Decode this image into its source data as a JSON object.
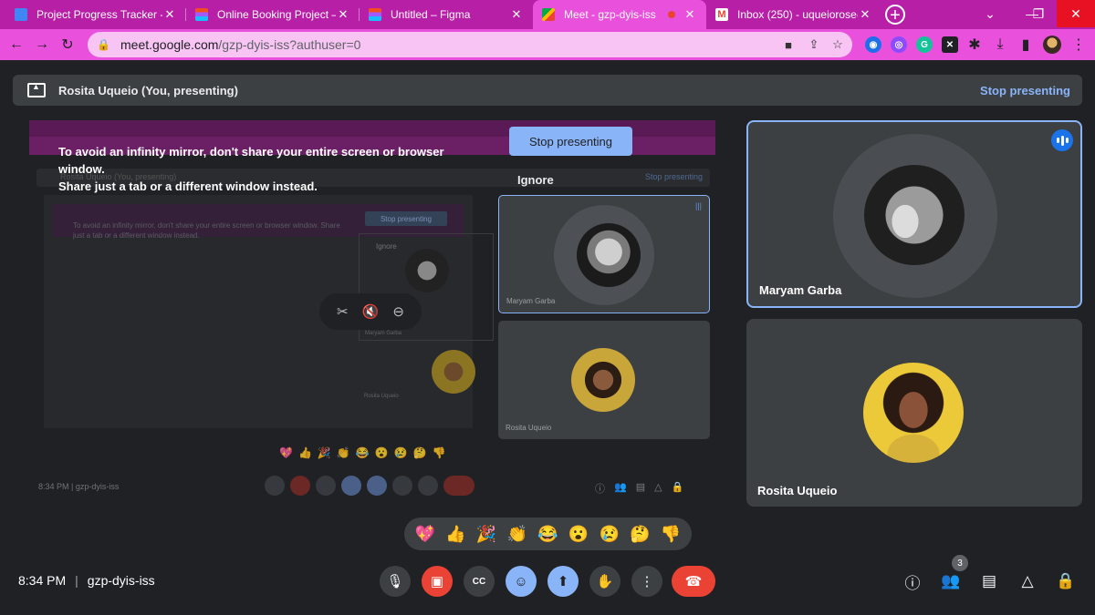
{
  "browser": {
    "tabs": [
      {
        "title": "Project Progress Tracker - Go",
        "icon": "docs-icon",
        "color": "#4285f4"
      },
      {
        "title": "Online Booking Project – Fig",
        "icon": "figma-icon",
        "color": "#a259ff"
      },
      {
        "title": "Untitled – Figma",
        "icon": "figma-icon",
        "color": "#a259ff"
      },
      {
        "title": "Meet - gzp-dyis-iss",
        "icon": "meet-icon",
        "color": "#00ac47"
      },
      {
        "title": "Inbox (250) - uqueiorose@g",
        "icon": "gmail-icon",
        "color": "#ea4335"
      }
    ],
    "url": "meet.google.com",
    "url_path": "/gzp-dyis-iss?authuser=0"
  },
  "presenting": {
    "label": "Rosita Uqueio (You, presenting)",
    "stop_link": "Stop presenting"
  },
  "mirror_warning": {
    "line1": "To avoid an infinity mirror, don't share your entire screen or browser window.",
    "line2": "Share just a tab or a different window instead.",
    "stop_button": "Stop presenting",
    "ignore": "Ignore"
  },
  "mirror_preview": {
    "presenting_label": "Rosita Uqueio (You, presenting)",
    "stop_link": "Stop presenting",
    "warning": "To avoid an infinity mirror, don't share your entire screen or browser window. Share just a tab or a different window instead.",
    "stop_button": "Stop presenting",
    "ignore": "Ignore",
    "tile1_name": "Maryam Garba",
    "tile2_name": "Rosita Uqueio",
    "time": "8:34 PM",
    "code": "gzp-dyis-iss"
  },
  "participants": [
    {
      "name": "Maryam Garba",
      "speaking": true
    },
    {
      "name": "Rosita Uqueio",
      "speaking": false
    }
  ],
  "reactions": [
    "💖",
    "👍",
    "🎉",
    "👏",
    "😂",
    "😮",
    "😢",
    "🤔",
    "👎"
  ],
  "meeting": {
    "time": "8:34 PM",
    "separator": "|",
    "code": "gzp-dyis-iss",
    "participant_count": "3"
  },
  "colors": {
    "accent": "#8ab4f8",
    "danger": "#ea4335",
    "tab_strip": "#b81fa7",
    "toolbar": "#e951dc"
  }
}
